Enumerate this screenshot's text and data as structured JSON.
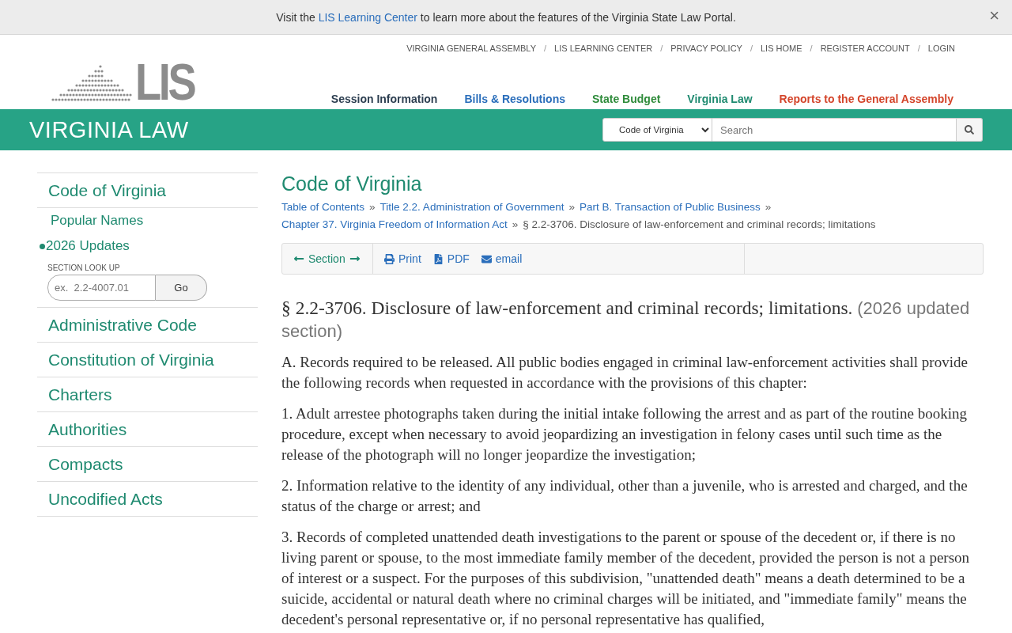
{
  "notice": {
    "before": "Visit the",
    "link": "LIS Learning Center",
    "after": "to learn more about the features of the Virginia State Law Portal.",
    "close": "×"
  },
  "logo": {
    "text": "LIS"
  },
  "utility_nav": [
    {
      "kind": "link",
      "text": "VIRGINIA GENERAL ASSEMBLY"
    },
    {
      "kind": "separator",
      "text": "/"
    },
    {
      "kind": "link",
      "text": "LIS LEARNING CENTER"
    },
    {
      "kind": "separator",
      "text": "/"
    },
    {
      "kind": "link",
      "text": "PRIVACY POLICY"
    },
    {
      "kind": "separator",
      "text": "/"
    },
    {
      "kind": "link",
      "text": "LIS HOME"
    },
    {
      "kind": "separator",
      "text": "/"
    },
    {
      "kind": "link",
      "text": "REGISTER ACCOUNT"
    },
    {
      "kind": "separator",
      "text": "/"
    },
    {
      "kind": "link",
      "text": "LOGIN"
    }
  ],
  "main_nav": [
    {
      "label": "Session Information",
      "color": "#2c3e50"
    },
    {
      "label": "Bills & Resolutions",
      "color": "#2a6ebb"
    },
    {
      "label": "State Budget",
      "color": "#2e8b3a"
    },
    {
      "label": "Virginia Law",
      "color": "#1f8a70"
    },
    {
      "label": "Reports to the General Assembly",
      "color": "#d4452b"
    }
  ],
  "section_bar": {
    "title": "VIRGINIA LAW",
    "scope": "Code of Virginia",
    "search_placeholder": "Search"
  },
  "sidebar": {
    "items": [
      {
        "kind": "heading",
        "label": "Code of Virginia",
        "selected": false
      },
      {
        "kind": "sub",
        "label": "Popular Names",
        "selected": false
      },
      {
        "kind": "sub",
        "label": "2026 Updates",
        "selected": true
      },
      {
        "kind": "lookup",
        "label": "SECTION LOOK UP",
        "placeholder": "ex.  2.2-4007.01",
        "button": "Go"
      },
      {
        "kind": "heading",
        "label": "Administrative Code",
        "selected": false
      },
      {
        "kind": "heading",
        "label": "Constitution of Virginia",
        "selected": false
      },
      {
        "kind": "heading",
        "label": "Charters",
        "selected": false
      },
      {
        "kind": "heading",
        "label": "Authorities",
        "selected": false
      },
      {
        "kind": "heading",
        "label": "Compacts",
        "selected": false
      },
      {
        "kind": "heading",
        "label": "Uncodified Acts",
        "selected": false
      }
    ]
  },
  "content": {
    "title": "Code of Virginia",
    "breadcrumbs": [
      {
        "kind": "link",
        "text": "Table of Contents"
      },
      {
        "kind": "separator",
        "text": "»"
      },
      {
        "kind": "link",
        "text": "Title 2.2. Administration of Government"
      },
      {
        "kind": "separator",
        "text": "»"
      },
      {
        "kind": "link",
        "text": "Part B. Transaction of Public Business"
      },
      {
        "kind": "separator",
        "text": "»"
      },
      {
        "kind": "link",
        "text": "Chapter 37. Virginia Freedom of Information Act"
      },
      {
        "kind": "separator",
        "text": "»"
      },
      {
        "kind": "current",
        "text": "§ 2.2-3706. Disclosure of law-enforcement and criminal records; limitations"
      }
    ],
    "toolbar": {
      "section": "Section",
      "actions": [
        {
          "kind": "print",
          "label": "Print"
        },
        {
          "kind": "pdf",
          "label": "PDF"
        },
        {
          "kind": "email",
          "label": "email"
        }
      ]
    },
    "heading": "§ 2.2-3706. Disclosure of law-enforcement and criminal records; limitations.",
    "heading_note": "(2026 updated section)",
    "paragraphs": [
      "A. Records required to be released. All public bodies engaged in criminal law-enforcement activities shall provide the following records when requested in accordance with the provisions of this chapter:",
      "1. Adult arrestee photographs taken during the initial intake following the arrest and as part of the routine booking procedure, except when necessary to avoid jeopardizing an investigation in felony cases until such time as the release of the photograph will no longer jeopardize the investigation;",
      "2. Information relative to the identity of any individual, other than a juvenile, who is arrested and charged, and the status of the charge or arrest; and",
      "3. Records of completed unattended death investigations to the parent or spouse of the decedent or, if there is no living parent or spouse, to the most immediate family member of the decedent, provided the person is not a person of interest or a suspect. For the purposes of this subdivision, \"unattended death\" means a death determined to be a suicide, accidental or natural death where no criminal charges will be initiated, and \"immediate family\" means the decedent's personal representative or, if no personal representative has qualified,"
    ]
  }
}
